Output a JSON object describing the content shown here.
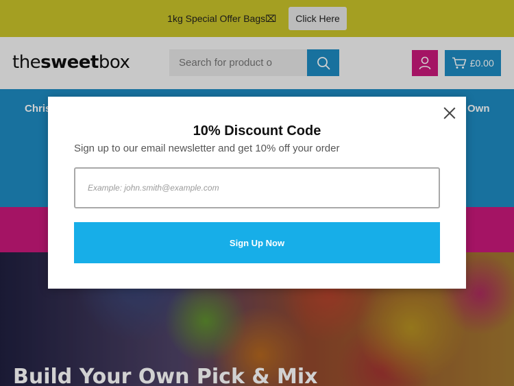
{
  "promo": {
    "text": "1kg Special Offer Bags⌧",
    "button_label": "Click Here"
  },
  "header": {
    "logo_part1": "the",
    "logo_part2": "sweet",
    "logo_part3": "box",
    "search_placeholder": "Search for product o",
    "cart_total": "£0.00",
    "icons": [
      "search-icon",
      "user-icon",
      "cart-icon"
    ]
  },
  "nav": {
    "left_partial": "Chris",
    "right_partial": "Own"
  },
  "hero": {
    "title": "Build Your Own Pick & Mix"
  },
  "modal": {
    "title": "10% Discount Code",
    "subtitle": "Sign up to our email newsletter and get 10% off your order",
    "email_placeholder": "Example: john.smith@example.com",
    "email_value": "",
    "submit_label": "Sign Up Now"
  },
  "colors": {
    "promo_bg": "#c9c22a",
    "brand_blue": "#1e8ac1",
    "brand_pink": "#c8197b",
    "signup_button": "#17aee8"
  }
}
